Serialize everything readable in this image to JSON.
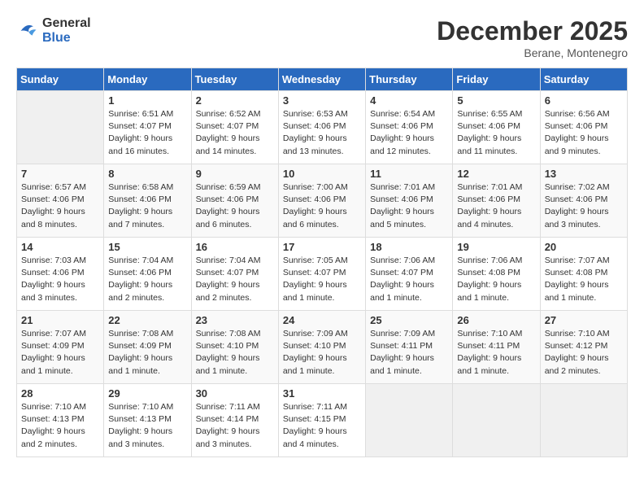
{
  "header": {
    "logo_line1": "General",
    "logo_line2": "Blue",
    "month": "December 2025",
    "location": "Berane, Montenegro"
  },
  "weekdays": [
    "Sunday",
    "Monday",
    "Tuesday",
    "Wednesday",
    "Thursday",
    "Friday",
    "Saturday"
  ],
  "weeks": [
    [
      {
        "day": "",
        "empty": true
      },
      {
        "day": "1",
        "sunrise": "Sunrise: 6:51 AM",
        "sunset": "Sunset: 4:07 PM",
        "daylight": "Daylight: 9 hours and 16 minutes."
      },
      {
        "day": "2",
        "sunrise": "Sunrise: 6:52 AM",
        "sunset": "Sunset: 4:07 PM",
        "daylight": "Daylight: 9 hours and 14 minutes."
      },
      {
        "day": "3",
        "sunrise": "Sunrise: 6:53 AM",
        "sunset": "Sunset: 4:06 PM",
        "daylight": "Daylight: 9 hours and 13 minutes."
      },
      {
        "day": "4",
        "sunrise": "Sunrise: 6:54 AM",
        "sunset": "Sunset: 4:06 PM",
        "daylight": "Daylight: 9 hours and 12 minutes."
      },
      {
        "day": "5",
        "sunrise": "Sunrise: 6:55 AM",
        "sunset": "Sunset: 4:06 PM",
        "daylight": "Daylight: 9 hours and 11 minutes."
      },
      {
        "day": "6",
        "sunrise": "Sunrise: 6:56 AM",
        "sunset": "Sunset: 4:06 PM",
        "daylight": "Daylight: 9 hours and 9 minutes."
      }
    ],
    [
      {
        "day": "7",
        "sunrise": "Sunrise: 6:57 AM",
        "sunset": "Sunset: 4:06 PM",
        "daylight": "Daylight: 9 hours and 8 minutes."
      },
      {
        "day": "8",
        "sunrise": "Sunrise: 6:58 AM",
        "sunset": "Sunset: 4:06 PM",
        "daylight": "Daylight: 9 hours and 7 minutes."
      },
      {
        "day": "9",
        "sunrise": "Sunrise: 6:59 AM",
        "sunset": "Sunset: 4:06 PM",
        "daylight": "Daylight: 9 hours and 6 minutes."
      },
      {
        "day": "10",
        "sunrise": "Sunrise: 7:00 AM",
        "sunset": "Sunset: 4:06 PM",
        "daylight": "Daylight: 9 hours and 6 minutes."
      },
      {
        "day": "11",
        "sunrise": "Sunrise: 7:01 AM",
        "sunset": "Sunset: 4:06 PM",
        "daylight": "Daylight: 9 hours and 5 minutes."
      },
      {
        "day": "12",
        "sunrise": "Sunrise: 7:01 AM",
        "sunset": "Sunset: 4:06 PM",
        "daylight": "Daylight: 9 hours and 4 minutes."
      },
      {
        "day": "13",
        "sunrise": "Sunrise: 7:02 AM",
        "sunset": "Sunset: 4:06 PM",
        "daylight": "Daylight: 9 hours and 3 minutes."
      }
    ],
    [
      {
        "day": "14",
        "sunrise": "Sunrise: 7:03 AM",
        "sunset": "Sunset: 4:06 PM",
        "daylight": "Daylight: 9 hours and 3 minutes."
      },
      {
        "day": "15",
        "sunrise": "Sunrise: 7:04 AM",
        "sunset": "Sunset: 4:06 PM",
        "daylight": "Daylight: 9 hours and 2 minutes."
      },
      {
        "day": "16",
        "sunrise": "Sunrise: 7:04 AM",
        "sunset": "Sunset: 4:07 PM",
        "daylight": "Daylight: 9 hours and 2 minutes."
      },
      {
        "day": "17",
        "sunrise": "Sunrise: 7:05 AM",
        "sunset": "Sunset: 4:07 PM",
        "daylight": "Daylight: 9 hours and 1 minute."
      },
      {
        "day": "18",
        "sunrise": "Sunrise: 7:06 AM",
        "sunset": "Sunset: 4:07 PM",
        "daylight": "Daylight: 9 hours and 1 minute."
      },
      {
        "day": "19",
        "sunrise": "Sunrise: 7:06 AM",
        "sunset": "Sunset: 4:08 PM",
        "daylight": "Daylight: 9 hours and 1 minute."
      },
      {
        "day": "20",
        "sunrise": "Sunrise: 7:07 AM",
        "sunset": "Sunset: 4:08 PM",
        "daylight": "Daylight: 9 hours and 1 minute."
      }
    ],
    [
      {
        "day": "21",
        "sunrise": "Sunrise: 7:07 AM",
        "sunset": "Sunset: 4:09 PM",
        "daylight": "Daylight: 9 hours and 1 minute."
      },
      {
        "day": "22",
        "sunrise": "Sunrise: 7:08 AM",
        "sunset": "Sunset: 4:09 PM",
        "daylight": "Daylight: 9 hours and 1 minute."
      },
      {
        "day": "23",
        "sunrise": "Sunrise: 7:08 AM",
        "sunset": "Sunset: 4:10 PM",
        "daylight": "Daylight: 9 hours and 1 minute."
      },
      {
        "day": "24",
        "sunrise": "Sunrise: 7:09 AM",
        "sunset": "Sunset: 4:10 PM",
        "daylight": "Daylight: 9 hours and 1 minute."
      },
      {
        "day": "25",
        "sunrise": "Sunrise: 7:09 AM",
        "sunset": "Sunset: 4:11 PM",
        "daylight": "Daylight: 9 hours and 1 minute."
      },
      {
        "day": "26",
        "sunrise": "Sunrise: 7:10 AM",
        "sunset": "Sunset: 4:11 PM",
        "daylight": "Daylight: 9 hours and 1 minute."
      },
      {
        "day": "27",
        "sunrise": "Sunrise: 7:10 AM",
        "sunset": "Sunset: 4:12 PM",
        "daylight": "Daylight: 9 hours and 2 minutes."
      }
    ],
    [
      {
        "day": "28",
        "sunrise": "Sunrise: 7:10 AM",
        "sunset": "Sunset: 4:13 PM",
        "daylight": "Daylight: 9 hours and 2 minutes."
      },
      {
        "day": "29",
        "sunrise": "Sunrise: 7:10 AM",
        "sunset": "Sunset: 4:13 PM",
        "daylight": "Daylight: 9 hours and 3 minutes."
      },
      {
        "day": "30",
        "sunrise": "Sunrise: 7:11 AM",
        "sunset": "Sunset: 4:14 PM",
        "daylight": "Daylight: 9 hours and 3 minutes."
      },
      {
        "day": "31",
        "sunrise": "Sunrise: 7:11 AM",
        "sunset": "Sunset: 4:15 PM",
        "daylight": "Daylight: 9 hours and 4 minutes."
      },
      {
        "day": "",
        "empty": true
      },
      {
        "day": "",
        "empty": true
      },
      {
        "day": "",
        "empty": true
      }
    ]
  ]
}
